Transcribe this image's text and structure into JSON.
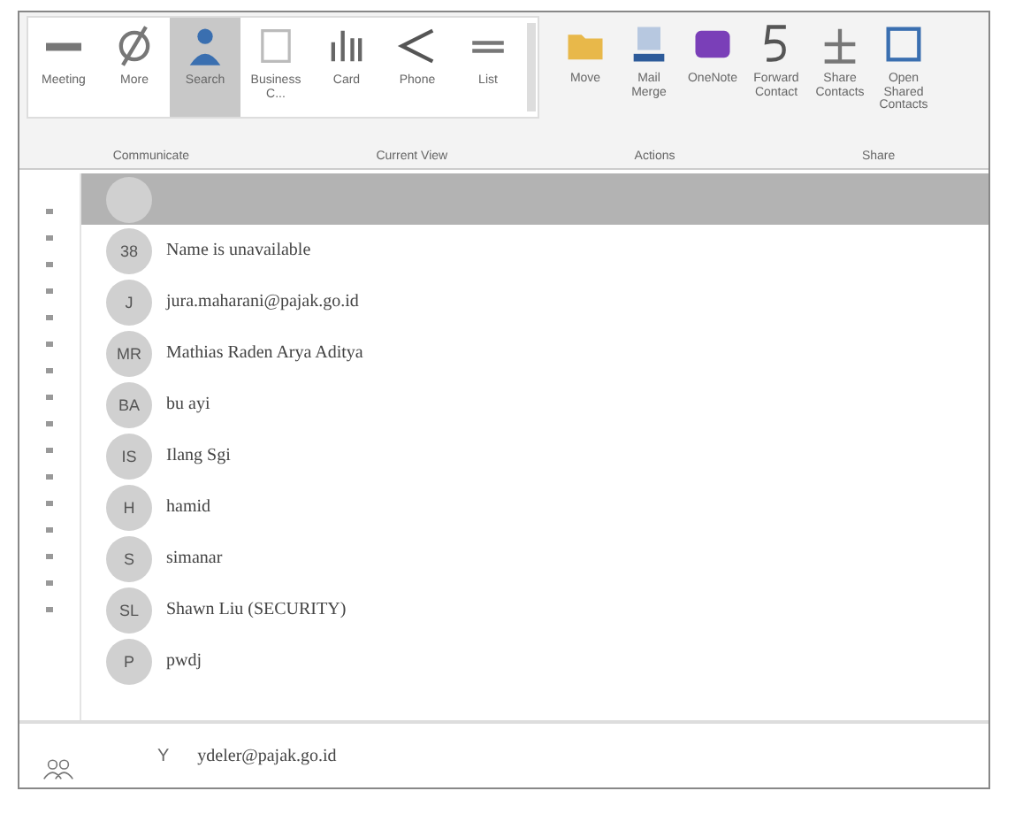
{
  "ribbon": {
    "buttons": [
      {
        "label": "Meeting",
        "kind": "dash"
      },
      {
        "label": "More",
        "kind": "slash"
      },
      {
        "label": "Search",
        "kind": "person",
        "selected": true
      },
      {
        "label": "Business C...",
        "kind": "card",
        "selected": false
      },
      {
        "label": "Card",
        "kind": "bars",
        "selected": false
      },
      {
        "label": "Phone",
        "kind": "chevron",
        "selected": false
      },
      {
        "label": "List",
        "kind": "lines",
        "selected": false
      },
      {
        "label": "Move",
        "kind": "folder"
      },
      {
        "label": "Mail Merge",
        "kind": "merge"
      },
      {
        "label": "OneNote",
        "kind": "note"
      },
      {
        "label": "Forward Contact",
        "kind": "five"
      },
      {
        "label": "Share Contacts",
        "kind": "plus"
      },
      {
        "label": "Open Shared Contacts",
        "kind": "box"
      }
    ],
    "groups": [
      "Communicate",
      "Current View",
      "Actions",
      "Share"
    ]
  },
  "contacts": [
    {
      "selected": true
    },
    {
      "name": "Name is unavailable",
      "initials": "38",
      "selected": false
    },
    {
      "name": "jura.maharani@pajak.go.id",
      "initials": "J",
      "selected": false
    },
    {
      "name": "Mathias Raden Arya Aditya",
      "initials": "MR",
      "selected": false
    },
    {
      "name": "bu ayi",
      "initials": "BA",
      "selected": false
    },
    {
      "name": "Ilang Sgi",
      "initials": "IS",
      "selected": false
    },
    {
      "name": "hamid",
      "initials": "H",
      "selected": false
    },
    {
      "name": "simanar",
      "initials": "S",
      "selected": false
    },
    {
      "name": "Shawn Liu (SECURITY)",
      "initials": "SL",
      "selected": false
    },
    {
      "name": "pwdj",
      "initials": "P",
      "selected": false
    }
  ],
  "footer": {
    "initials": "Y",
    "name": "ydeler@pajak.go.id"
  }
}
